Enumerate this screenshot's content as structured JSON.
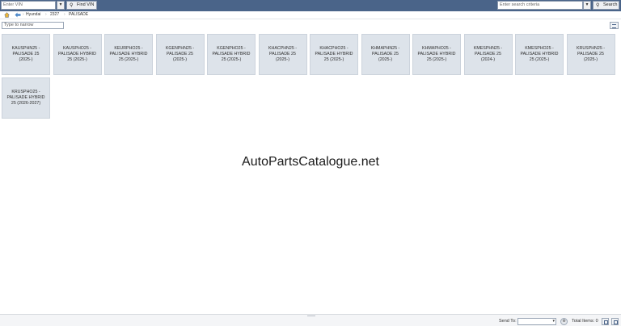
{
  "toolbar": {
    "vin_placeholder": "Enter VIN",
    "find_vin_label": "Find VIN",
    "search_placeholder": "Enter search criteria",
    "search_label": "Search"
  },
  "breadcrumb": [
    "Hyundai",
    "2327",
    "PALISADE"
  ],
  "filter": {
    "placeholder": "Type to narrow"
  },
  "tiles": [
    [
      "KAUSPHN25 -",
      "PALISADE 25",
      "(2025-)"
    ],
    [
      "KAUSPHO25 -",
      "PALISADE HYBRID",
      "25 (2025-)"
    ],
    [
      "KEURPHO25 -",
      "PALISADE HYBRID",
      "25 (2025-)"
    ],
    [
      "KGENPHN25 -",
      "PALISADE 25",
      "(2025-)"
    ],
    [
      "KGENPHO25 -",
      "PALISADE HYBRID",
      "25 (2025-)"
    ],
    [
      "KHACPHN25 -",
      "PALISADE 25",
      "(2025-)"
    ],
    [
      "KHACPHO25 -",
      "PALISADE HYBRID",
      "25 (2025-)"
    ],
    [
      "KHMAPHN25 -",
      "PALISADE 25",
      "(2025-)"
    ],
    [
      "KHMAPHO25 -",
      "PALISADE HYBRID",
      "25 (2025-)"
    ],
    [
      "KMESPHN25 -",
      "PALISADE 25",
      "(2024-)"
    ],
    [
      "KMESPHO25 -",
      "PALISADE HYBRID",
      "25 (2025-)"
    ],
    [
      "KRUSPHN25 -",
      "PALISADE 25",
      "(2025-)"
    ],
    [
      "KRUSPHO25 -",
      "PALISADE HYBRID",
      "25 (2026-2027)"
    ]
  ],
  "watermark": "AutoPartsCatalogue.net",
  "status": {
    "send_to_label": "Send To:",
    "total_items_label": "Total Items: 0"
  },
  "colors": {
    "toolbar": "#4a6489",
    "tile": "#dde3ea"
  }
}
